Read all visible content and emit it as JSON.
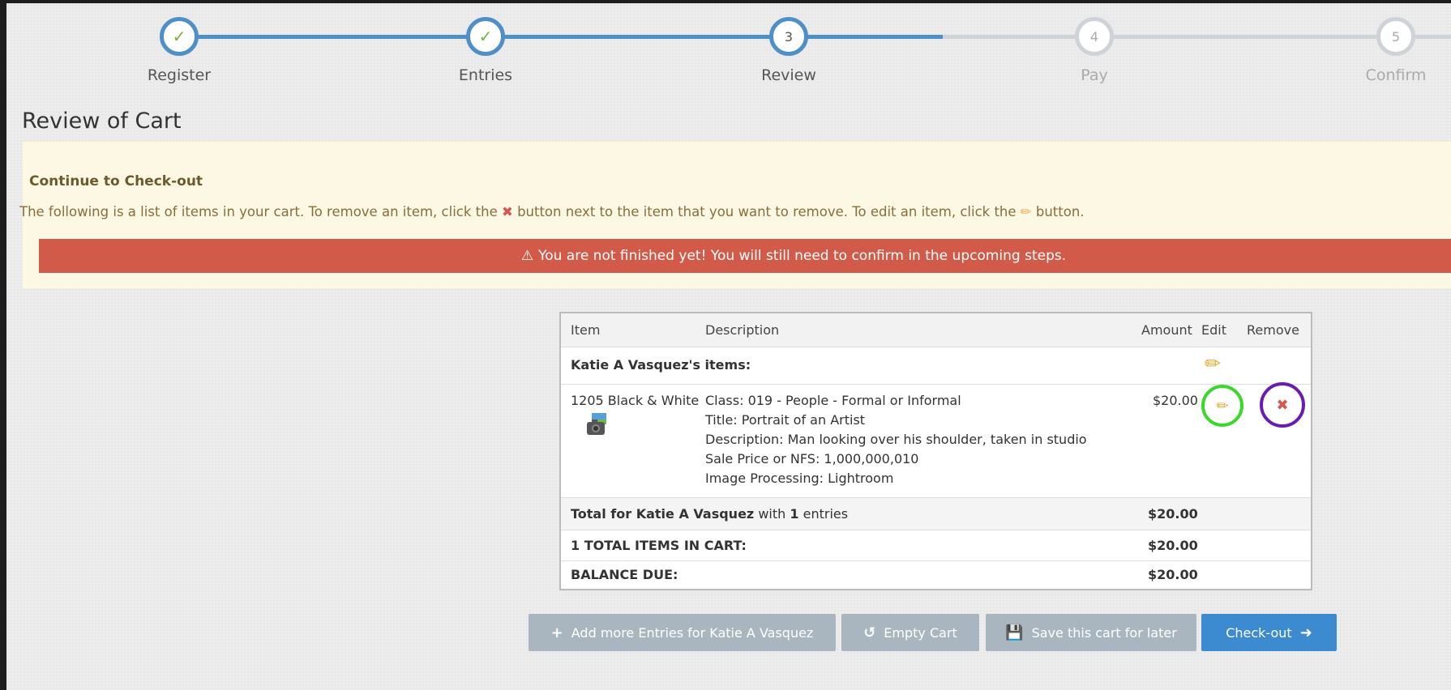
{
  "stepper": {
    "steps": [
      {
        "label": "Register",
        "number": "",
        "status": "done"
      },
      {
        "label": "Entries",
        "number": "",
        "status": "done"
      },
      {
        "label": "Review",
        "number": "3",
        "status": "current"
      },
      {
        "label": "Pay",
        "number": "4",
        "status": "todo"
      },
      {
        "label": "Confirm",
        "number": "5",
        "status": "todo"
      }
    ]
  },
  "page_title": "Review of Cart",
  "alert": {
    "heading": "Continue to Check-out",
    "text_before_x": "The following is a list of items in your cart. To remove an item, click the",
    "text_after_x": "button next to the item that you want to remove. To edit an item, click the",
    "text_end": "button.",
    "warning": "You are not finished yet! You will still need to confirm in the upcoming steps."
  },
  "cart": {
    "headers": {
      "item": "Item",
      "description": "Description",
      "amount": "Amount",
      "edit": "Edit",
      "remove": "Remove"
    },
    "group_label": "Katie A Vasquez's items:",
    "entry": {
      "item": "1205 Black & White",
      "description": [
        "Class: 019 - People - Formal or Informal",
        "Title: Portrait of an Artist",
        "Description: Man looking over his shoulder, taken in studio",
        "Sale Price or NFS: 1,000,000,010",
        "Image Processing: Lightroom"
      ],
      "amount": "$20.00"
    },
    "total_prefix": "Total for Katie A Vasquez",
    "total_with": "with",
    "total_count": "1",
    "total_suffix": "entries",
    "total_amount": "$20.00",
    "total_items_label": "1 TOTAL ITEMS IN CART:",
    "total_items_amount": "$20.00",
    "balance_label": "BALANCE DUE:",
    "balance_amount": "$20.00"
  },
  "buttons": {
    "add_more": "Add more Entries for Katie A Vasquez",
    "empty_cart": "Empty Cart",
    "save_later": "Save this cart for later",
    "checkout": "Check-out"
  },
  "colors": {
    "step_done": "#4f8fc8",
    "step_todo": "#cfd3d8",
    "warning_bar": "#d25a48",
    "alert_bg": "#fcf8e3",
    "primary_button": "#3c8ad0",
    "secondary_button": "#a9b6c0",
    "edit_highlight": "#39d92b",
    "remove_highlight": "#6a1bb2"
  }
}
